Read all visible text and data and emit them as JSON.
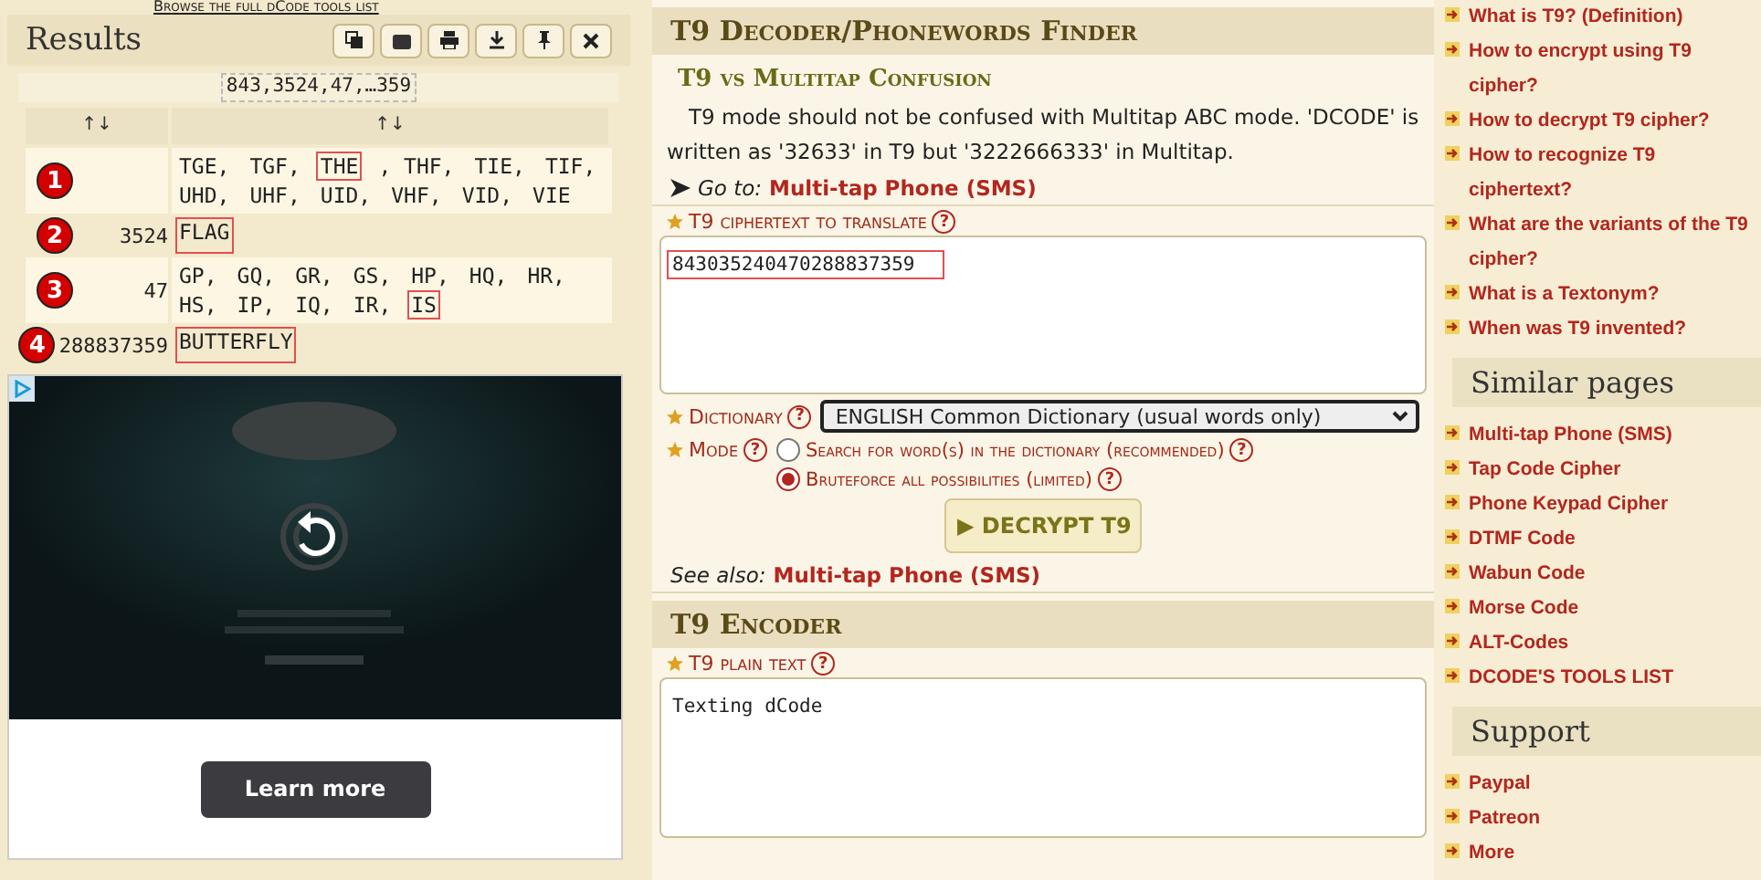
{
  "top_link": "Browse the full dCode tools list",
  "results": {
    "title": "Results",
    "tools": [
      {
        "kind": "copy"
      },
      {
        "kind": "screenshot"
      },
      {
        "kind": "print"
      },
      {
        "kind": "download"
      },
      {
        "kind": "pin"
      },
      {
        "kind": "close"
      }
    ],
    "summary": "843,3524,47,…359",
    "columns": [
      "↑↓",
      "↑↓"
    ],
    "rows": [
      {
        "marker": "1",
        "number": "",
        "words": [
          {
            "text": "TGE,",
            "highlighted": false
          },
          {
            "text": "TGF,",
            "highlighted": false
          },
          {
            "text": "THE",
            "highlighted": true
          },
          {
            "text": ", THF,",
            "highlighted": false
          },
          {
            "text": "TIE,",
            "highlighted": false
          },
          {
            "text": "TIF,",
            "highlighted": false
          },
          {
            "text": "UHD,",
            "highlighted": false
          },
          {
            "text": "UHF,",
            "highlighted": false
          },
          {
            "text": "UID,",
            "highlighted": false
          },
          {
            "text": "VHF,",
            "highlighted": false
          },
          {
            "text": "VID,",
            "highlighted": false
          },
          {
            "text": "VIE",
            "highlighted": false
          }
        ]
      },
      {
        "marker": "2",
        "number": "3524",
        "words": [
          {
            "text": "FLAG",
            "highlighted": true
          }
        ]
      },
      {
        "marker": "3",
        "number": "47",
        "words": [
          {
            "text": "GP,",
            "highlighted": false
          },
          {
            "text": "GQ,",
            "highlighted": false
          },
          {
            "text": "GR,",
            "highlighted": false
          },
          {
            "text": "GS,",
            "highlighted": false
          },
          {
            "text": "HP,",
            "highlighted": false
          },
          {
            "text": "HQ,",
            "highlighted": false
          },
          {
            "text": "HR,",
            "highlighted": false
          },
          {
            "text": "HS,",
            "highlighted": false
          },
          {
            "text": "IP,",
            "highlighted": false
          },
          {
            "text": "IQ,",
            "highlighted": false
          },
          {
            "text": "IR,",
            "highlighted": false
          },
          {
            "text": "IS",
            "highlighted": true
          }
        ]
      },
      {
        "marker": "4",
        "number": "288837359",
        "words": [
          {
            "text": "BUTTERFLY",
            "highlighted": true
          }
        ]
      }
    ]
  },
  "ad": {
    "kind": "picture",
    "button": "Learn more"
  },
  "decoder": {
    "title": "T9 Decoder/Phonewords Finder",
    "subtitle": "T9 vs Multitap Confusion",
    "paragraph": "T9 mode should not be confused with Multitap ABC mode. 'DCODE' is written as '32633' in T9 but '3222666333' in Multitap.",
    "goto_label": "Go to:",
    "goto_link": "Multi-tap Phone (SMS)",
    "cipher_label": "T9 ciphertext to translate",
    "cipher_help": "?",
    "cipher_value": "843035240470288837359",
    "dictionary_label": "Dictionary",
    "dictionary_help": "?",
    "dictionary_value": "ENGLISH Common Dictionary (usual words only)",
    "mode_label": "Mode",
    "mode_help": "?",
    "modes": [
      {
        "label": "Search for word(s) in the dictionary (recommended)",
        "help": "?",
        "selected": false
      },
      {
        "label": "Bruteforce all possibilities (limited)",
        "help": "?",
        "selected": true
      }
    ],
    "button": "▶ DECRYPT T9",
    "see_also_label": "See also:",
    "see_also_link": "Multi-tap Phone (SMS)"
  },
  "encoder": {
    "title": "T9 Encoder",
    "label": "T9 plain text",
    "help": "?",
    "value": "Texting dCode"
  },
  "sidebar": {
    "faq": [
      "What is T9? (Definition)",
      "How to encrypt using T9 cipher?",
      "How to decrypt T9 cipher?",
      "How to recognize T9 ciphertext?",
      "What are the variants of the T9 cipher?",
      "What is a Textonym?",
      "When was T9 invented?"
    ],
    "sections": [
      {
        "title": "Similar pages",
        "links": [
          "Multi-tap Phone (SMS)",
          "Tap Code Cipher",
          "Phone Keypad Cipher",
          "DTMF Code",
          "Wabun Code",
          "Morse Code",
          "ALT-Codes",
          "DCODE'S TOOLS LIST"
        ]
      },
      {
        "title": "Support",
        "links": [
          "Paypal",
          "Patreon",
          "More"
        ]
      }
    ]
  }
}
